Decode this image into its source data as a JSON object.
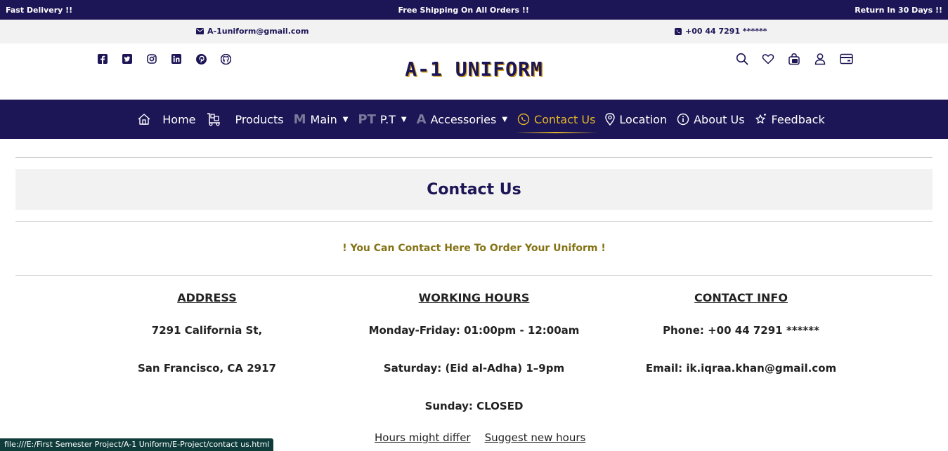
{
  "topbar": {
    "left": "Fast Delivery !!",
    "center": "Free Shipping On All Orders !!",
    "right": "Return In 30 Days !!"
  },
  "contact_strip": {
    "email": "A-1uniform@gmail.com",
    "phone": "+00 44 7291 ******",
    "email_icon": "envelope-icon",
    "phone_icon": "phone-icon"
  },
  "header": {
    "brand": "A-1 UNIFORM",
    "social_icons": [
      "facebook-icon",
      "twitter-icon",
      "instagram-icon",
      "linkedin-icon",
      "pinterest-icon",
      "github-icon"
    ],
    "tool_icons": [
      "search-icon",
      "heart-icon",
      "bag-icon",
      "user-icon",
      "card-icon"
    ]
  },
  "nav": {
    "home": "Home",
    "products": "Products",
    "main_prefix": "M",
    "main": "Main",
    "pt_prefix": "PT",
    "pt": "P.T",
    "accessories_prefix": "A",
    "accessories": "Accessories",
    "contact": "Contact Us",
    "location": "Location",
    "about": "About Us",
    "feedback": "Feedback"
  },
  "page": {
    "title": "Contact Us",
    "tagline": "! You Can Contact Here To Order Your Uniform !"
  },
  "address": {
    "heading": "ADDRESS",
    "line1": "7291 California St,",
    "line2": "San Francisco, CA 2917"
  },
  "hours": {
    "heading": "WORKING HOURS",
    "weekdays": "Monday-Friday: 01:00pm - 12:00am",
    "saturday": "Saturday: (Eid al-Adha) 1–9pm",
    "sunday": "Sunday: CLOSED"
  },
  "contact_info": {
    "heading": "CONTACT INFO",
    "phone": "Phone: +00 44 7291 ******",
    "email": "Email: ik.iqraa.khan@gmail.com"
  },
  "links": {
    "differ": "Hours might differ",
    "suggest": "Suggest new hours"
  },
  "status_url": "file:///E:/First Semester Project/A-1 Uniform/E-Project/contact us.html",
  "colors": {
    "navy": "#1c1556",
    "gold": "#e0b52a",
    "olive": "#857316"
  }
}
